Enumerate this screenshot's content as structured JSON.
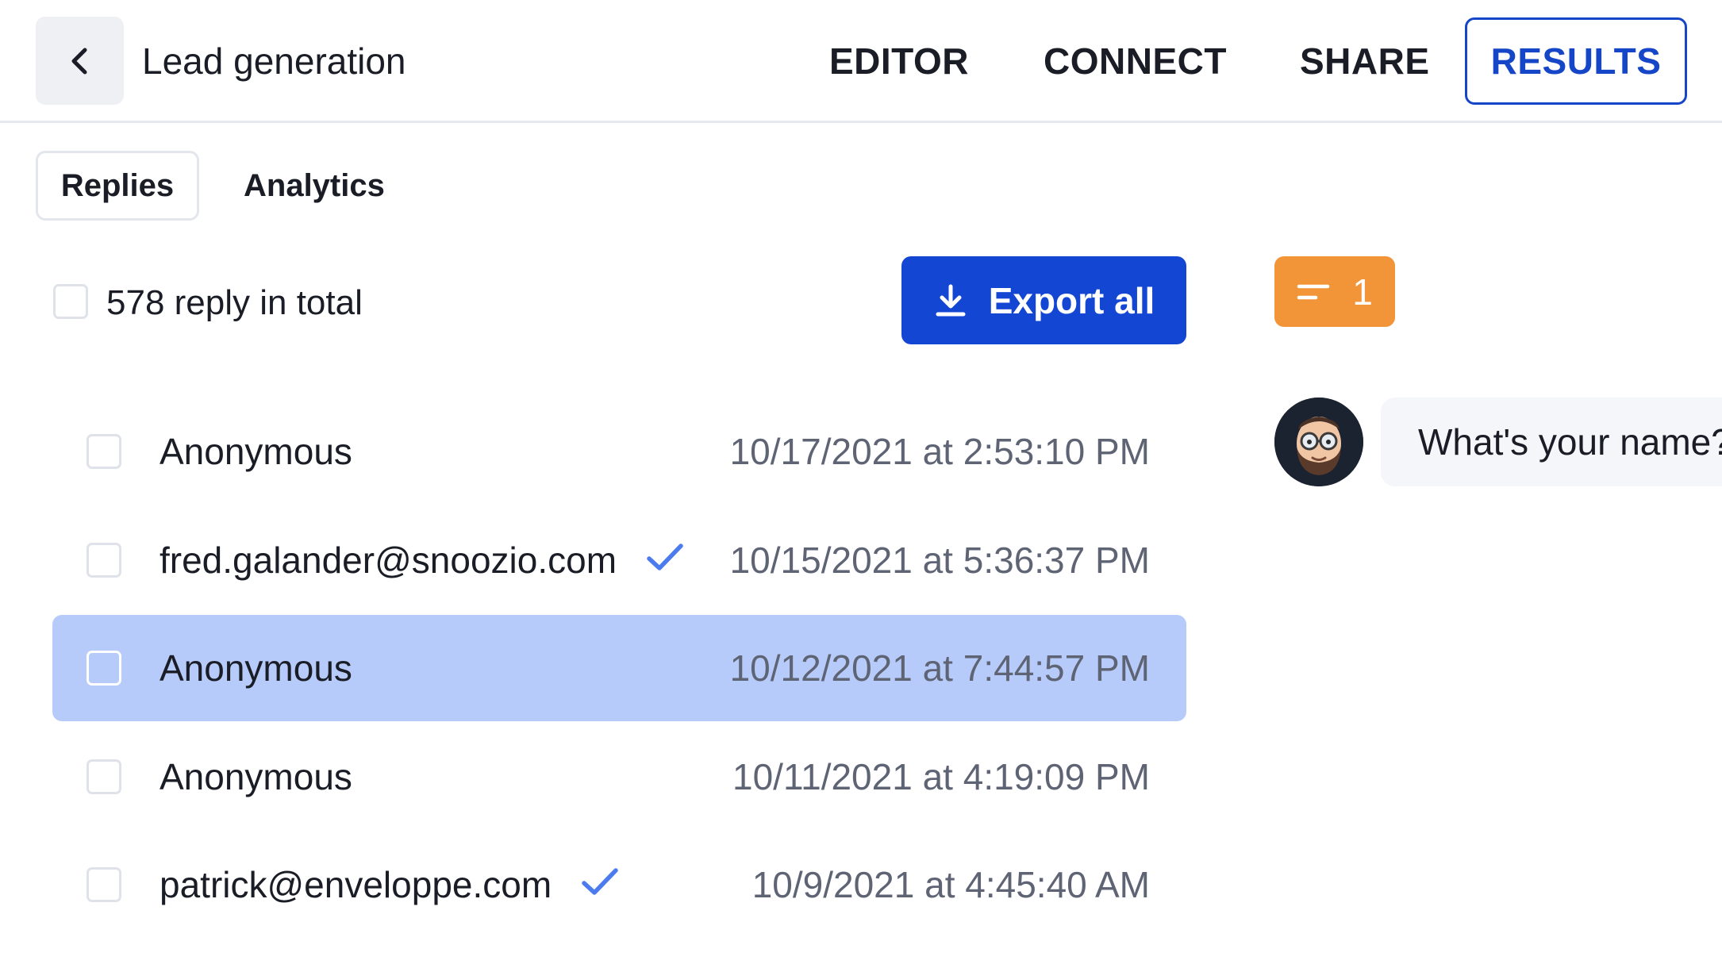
{
  "header": {
    "back_icon": "chevron-left-icon",
    "title": "Lead generation",
    "nav": [
      {
        "label": "EDITOR",
        "active": false
      },
      {
        "label": "CONNECT",
        "active": false
      },
      {
        "label": "SHARE",
        "active": false
      },
      {
        "label": "RESULTS",
        "active": true
      }
    ],
    "accent_color": "#1646c8"
  },
  "tabs": [
    {
      "label": "Replies",
      "active": true
    },
    {
      "label": "Analytics",
      "active": false
    }
  ],
  "summary": {
    "total_text": "578 reply in total",
    "export_label": "Export all",
    "export_icon": "download-icon",
    "export_color": "#1446d4"
  },
  "replies": [
    {
      "name": "Anonymous",
      "verified": false,
      "date": "10/17/2021 at 2:53:10 PM",
      "selected": false
    },
    {
      "name": "fred.galander@snoozio.com",
      "verified": true,
      "date": "10/15/2021 at 5:36:37 PM",
      "selected": false
    },
    {
      "name": "Anonymous",
      "verified": false,
      "date": "10/12/2021 at 7:44:57 PM",
      "selected": true
    },
    {
      "name": "Anonymous",
      "verified": false,
      "date": "10/11/2021 at 4:19:09 PM",
      "selected": false
    },
    {
      "name": "patrick@enveloppe.com",
      "verified": true,
      "date": "10/9/2021 at 4:45:40 AM",
      "selected": false
    }
  ],
  "filter": {
    "icon": "filter-lines-icon",
    "count": "1",
    "color": "#f29438"
  },
  "chat": {
    "avatar_icon": "bot-avatar-icon",
    "message": "What's your name?"
  }
}
